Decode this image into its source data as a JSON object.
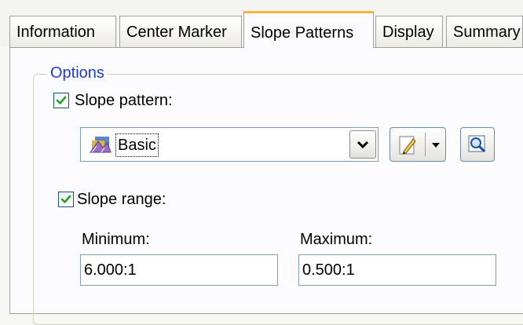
{
  "tabs": [
    {
      "label": "Information"
    },
    {
      "label": "Center Marker"
    },
    {
      "label": "Slope Patterns",
      "active": true
    },
    {
      "label": "Display"
    },
    {
      "label": "Summary"
    }
  ],
  "options": {
    "legend": "Options",
    "slope_pattern": {
      "label": "Slope pattern:",
      "checked": true,
      "selected": "Basic",
      "icon": "slope-pattern-style-icon"
    },
    "edit_button_icon": "pencil-edit-icon",
    "edit_dropdown_icon": "chevron-down-icon",
    "preview_button_icon": "magnifier-icon",
    "slope_range": {
      "label": "Slope range:",
      "checked": true,
      "minimum_label": "Minimum:",
      "minimum_value": "6.000:1",
      "maximum_label": "Maximum:",
      "maximum_value": "0.500:1"
    }
  },
  "colors": {
    "active_tab_accent": "#f1b446",
    "legend_text": "#1e3cc8",
    "check_mark": "#21a121"
  }
}
